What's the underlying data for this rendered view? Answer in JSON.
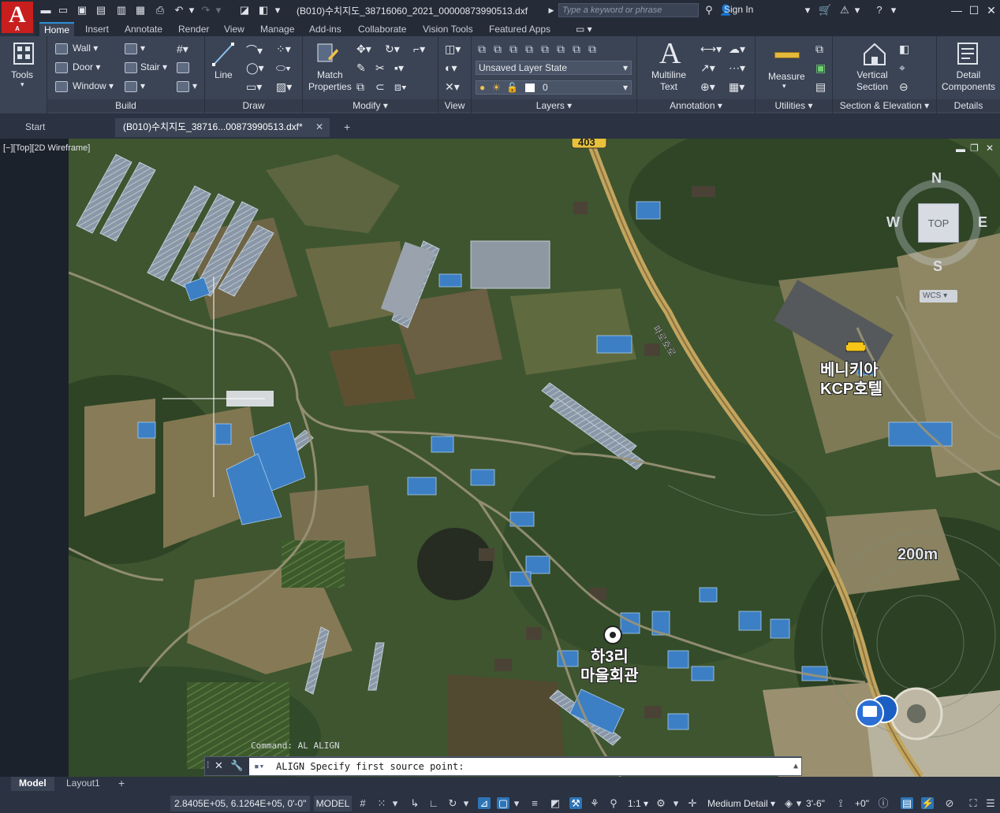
{
  "app": {
    "logo_letter": "A",
    "logo_sub": "A",
    "document_title": "(B010)수치지도_38716060_2021_00000873990513.dxf",
    "search_placeholder": "Type a keyword or phrase",
    "sign_in": "Sign In"
  },
  "menu_tabs": [
    "Home",
    "Insert",
    "Annotate",
    "Render",
    "View",
    "Manage",
    "Add-ins",
    "Collaborate",
    "Vision Tools",
    "Featured Apps"
  ],
  "ribbon": {
    "tools_label": "Tools",
    "build": {
      "title": "Build",
      "wall": "Wall",
      "door": "Door",
      "window": "Window",
      "stair": "Stair"
    },
    "draw": {
      "title": "Draw",
      "line": "Line"
    },
    "modify": {
      "title": "Modify",
      "match_properties": "Match Properties"
    },
    "view": {
      "title": "View"
    },
    "layers": {
      "title": "Layers",
      "layer_state": "Unsaved Layer State",
      "current_layer": "0"
    },
    "annotation": {
      "title": "Annotation",
      "multiline_text": "Multiline Text"
    },
    "utilities": {
      "title": "Utilities",
      "measure": "Measure"
    },
    "section_elevation": {
      "title": "Section & Elevation",
      "vertical_section": "Vertical Section"
    },
    "details": {
      "title": "Details",
      "detail_components": "Detail Components"
    }
  },
  "file_tabs": {
    "start": "Start",
    "active": "(B010)수치지도_38716...00873990513.dxf*"
  },
  "viewport": {
    "label": "[−][Top][2D Wireframe]",
    "map_labels": {
      "road_number": "403",
      "hotel": "베니키아\nKCP호텔",
      "village_hall": "하3리\n마을회관",
      "elevation": "200m",
      "road_name": "파로호로"
    },
    "viewcube": {
      "north": "N",
      "south": "S",
      "east": "E",
      "west": "W",
      "face": "TOP",
      "wcs": "WCS"
    }
  },
  "command": {
    "history": "Command: AL ALIGN",
    "prompt": "ALIGN Specify first source point:"
  },
  "layout_tabs": [
    "Model",
    "Layout1"
  ],
  "statusbar": {
    "coords": "2.8405E+05, 6.1264E+05, 0'-0\"",
    "model": "MODEL",
    "scale": "1:1",
    "detail": "Medium Detail",
    "dimension": "3'-6\"",
    "offset": "+0\""
  },
  "colors": {
    "accent": "#2d8fd8",
    "ribbon_bg": "#3b4455",
    "logo_red": "#c81e1e"
  }
}
